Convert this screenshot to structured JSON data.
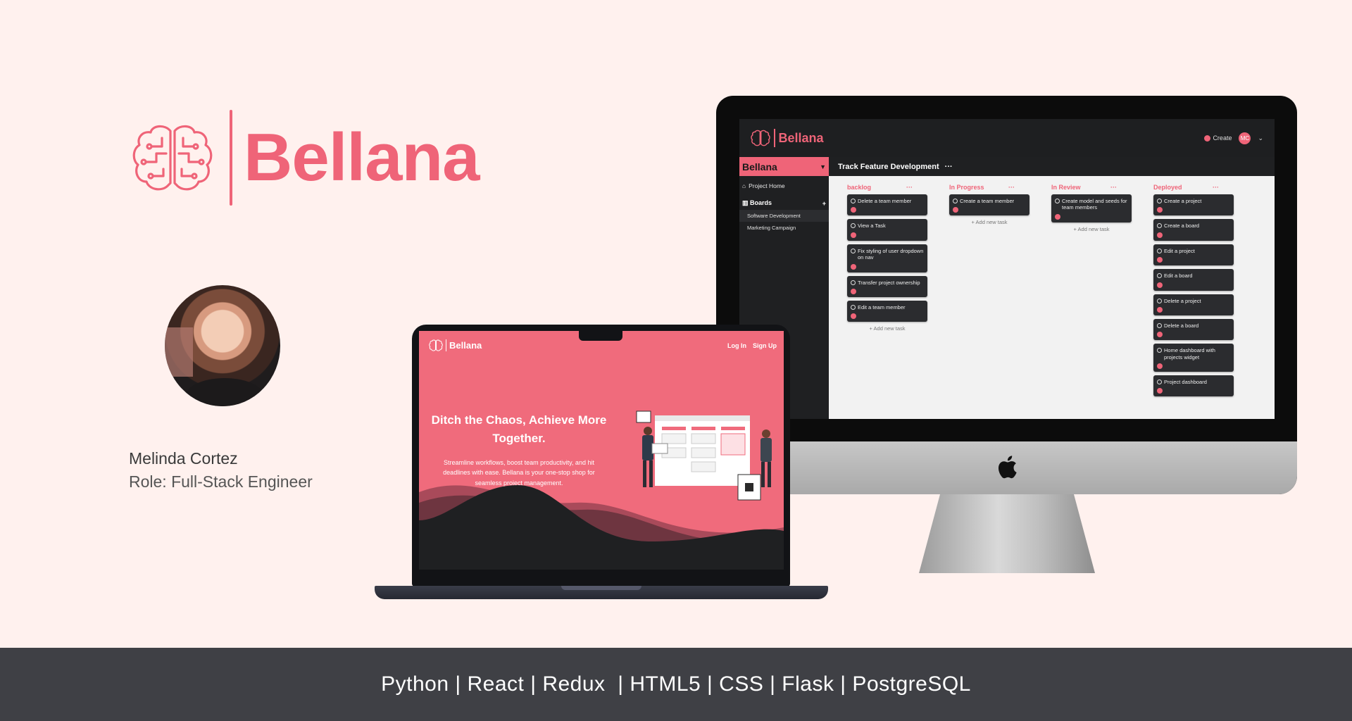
{
  "brand": {
    "name": "Bellana"
  },
  "person": {
    "name": "Melinda Cortez",
    "role": "Role: Full-Stack Engineer"
  },
  "app": {
    "logo_text": "Bellana",
    "create_label": "Create",
    "user_initials": "MC",
    "project_name": "Bellana",
    "project_home": "Project Home",
    "boards_heading": "Boards",
    "boards": [
      "Software Development",
      "Marketing Campaign"
    ],
    "board_title": "Track Feature Development",
    "add_task_label": "Add new task",
    "columns": [
      {
        "title": "backlog",
        "cards": [
          "Delete a team member",
          "View a Task",
          "Fix styling of user dropdown on nav",
          "Transfer project ownership",
          "Edit a team member"
        ]
      },
      {
        "title": "In Progress",
        "cards": [
          "Create a team member"
        ]
      },
      {
        "title": "In Review",
        "cards": [
          "Create model and seeds for team members"
        ]
      },
      {
        "title": "Deployed",
        "cards": [
          "Create a project",
          "Create a board",
          "Edit a project",
          "Edit a board",
          "Delete a project",
          "Delete a board",
          "Home dashboard with projects widget",
          "Project dashboard"
        ]
      }
    ]
  },
  "landing": {
    "logo_text": "Bellana",
    "login": "Log In",
    "signup": "Sign Up",
    "hero_title": "Ditch the Chaos, Achieve More Together.",
    "hero_text": "Streamline workflows, boost team productivity, and hit deadlines with ease. Bellana is your one-stop shop for seamless project management."
  },
  "footer": {
    "tech_stack": "Python | React | Redux  | HTML5 | CSS | Flask | PostgreSQL"
  },
  "colors": {
    "accent": "#ef6478",
    "background": "#fff1ee",
    "footer": "#3f4045",
    "dark": "#1e1f21"
  }
}
